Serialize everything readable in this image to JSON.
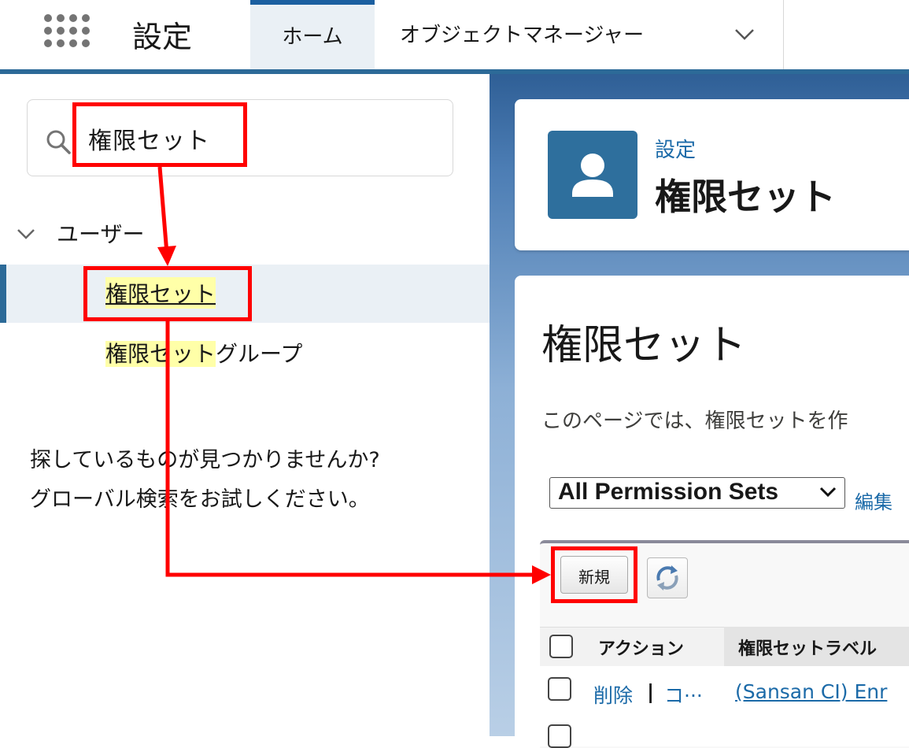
{
  "header": {
    "app_title": "設定",
    "tabs": [
      {
        "label": "ホーム",
        "active": true
      },
      {
        "label": "オブジェクトマネージャー",
        "active": false
      }
    ]
  },
  "sidebar": {
    "search": {
      "value": "権限セット"
    },
    "section": {
      "label": "ユーザー"
    },
    "items": [
      {
        "label": "権限セット",
        "selected": true
      },
      {
        "label_highlight": "権限セット",
        "label_rest": "グループ",
        "selected": false
      }
    ],
    "help": {
      "line1": "探しているものが見つかりませんか?",
      "line2": "グローバル検索をお試しください。"
    }
  },
  "page_header": {
    "breadcrumb": "設定",
    "title": "権限セット",
    "icon": "user-icon"
  },
  "content": {
    "heading": "権限セット",
    "description": "このページでは、権限セットを作",
    "view_select": "All Permission Sets",
    "edit_link": "編集",
    "new_button": "新規",
    "refresh_icon": "refresh-icon",
    "table": {
      "headers": [
        "アクション",
        "権限セットラベル"
      ],
      "rows": [
        {
          "delete": "削除",
          "separator": "|",
          "copy": "コ···",
          "label": "(Sansan CI) Enr"
        }
      ]
    }
  },
  "annotations": {
    "color": "#ff0000"
  },
  "colors": {
    "brand": "#2c6a98",
    "link": "#1b6aa8",
    "highlight": "#ffffa8"
  }
}
